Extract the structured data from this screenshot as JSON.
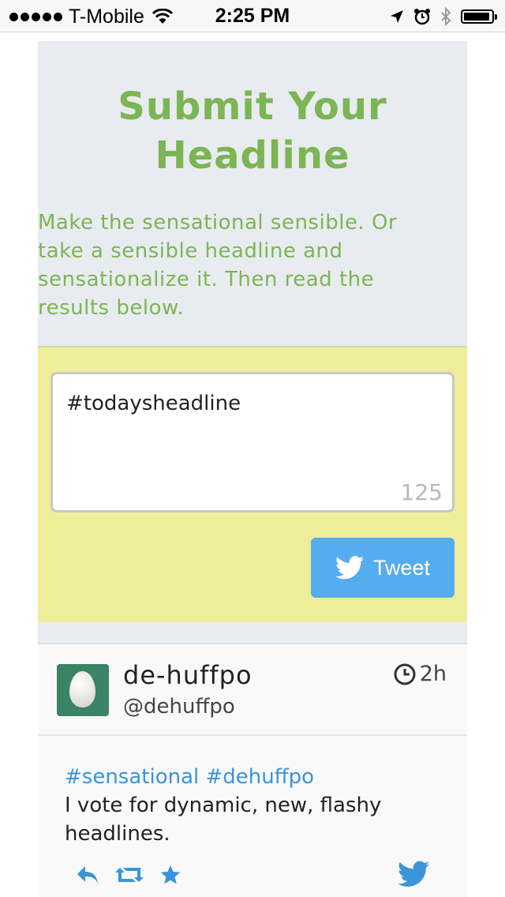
{
  "status_bar": {
    "carrier": "T-Mobile",
    "time": "2:25 PM",
    "battery_level": 0.95,
    "icons": [
      "signal-dots-icon",
      "wifi-icon",
      "location-arrow-icon",
      "alarm-icon",
      "bluetooth-icon",
      "battery-icon"
    ]
  },
  "header": {
    "title_line1": "Submit Your",
    "title_line2": "Headline",
    "intro": "Make the sensational sensible. Or take a sensible headline and sensationalize it. Then read the results below."
  },
  "compose": {
    "text_value": "#todaysheadline",
    "char_count": "125",
    "tweet_button_label": "Tweet"
  },
  "tweet": {
    "name": "de-huffpo",
    "handle": "@dehuffpo",
    "time": "2h",
    "hashtags": "#sensational #dehuffpo",
    "text": "I vote for dynamic, new, flashy headlines."
  },
  "colors": {
    "title_green": "#7cb553",
    "compose_bg": "#eded9a",
    "header_bg": "#e8ecf0",
    "twitter_blue": "#55acee",
    "link_blue": "#3b94d9",
    "avatar_bg": "#3b8466"
  }
}
